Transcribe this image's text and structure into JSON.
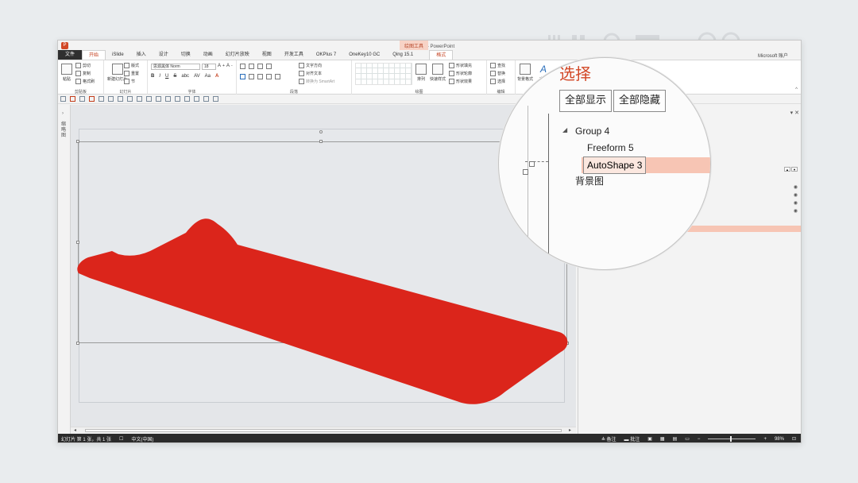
{
  "window": {
    "app_title": "演示文稿1 - PowerPoint",
    "context_tools": "绘图工具",
    "user": "Microsoft 账户"
  },
  "tabs": [
    "文件",
    "开始",
    "iSlide",
    "插入",
    "设计",
    "切换",
    "动画",
    "幻灯片放映",
    "视图",
    "开发工具",
    "OKPlus 7",
    "OneKey10 GC",
    "Qing 15.1",
    "格式"
  ],
  "ribbon": {
    "clipboard": {
      "paste": "粘贴",
      "cut": "剪切",
      "copy": "复制",
      "format_painter": "格式刷",
      "group": "剪贴板"
    },
    "slides": {
      "new": "新建幻灯片",
      "layout": "版式",
      "reset": "重置",
      "section": "节",
      "group": "幻灯片"
    },
    "font": {
      "font_name": "思源黑体 Norm",
      "font_size": "18",
      "group": "字体"
    },
    "paragraph": {
      "text_direction": "文字方向",
      "align_text": "对齐文本",
      "smartart": "转换为 SmartArt",
      "group": "段落"
    },
    "drawing": {
      "arrange": "排列",
      "quick_styles": "快速样式",
      "fill": "形状填充",
      "outline": "形状轮廓",
      "effects": "形状效果",
      "group": "绘图"
    },
    "editing": {
      "find": "查找",
      "replace": "替换",
      "select": "选择",
      "group": "编辑"
    },
    "extra": {
      "bg": "背景格式",
      "text": "文字"
    }
  },
  "thumb_strip": {
    "label": "缩略图"
  },
  "selection_pane": {
    "title": "选择",
    "show_all": "全部显示",
    "hide_all": "全部隐藏",
    "items": [
      "Group 4",
      "Freeform 5",
      "AutoShape 3",
      "背景图"
    ],
    "selected": "AutoShape 3"
  },
  "statusbar": {
    "slide_info": "幻灯片 第 1 张，共 1 张",
    "language": "中文(中国)",
    "notes": "备注",
    "comments": "批注",
    "zoom": "98%"
  },
  "colors": {
    "accent": "#d24726",
    "shape_fill": "#db251b",
    "highlight": "#f7c5b4"
  }
}
